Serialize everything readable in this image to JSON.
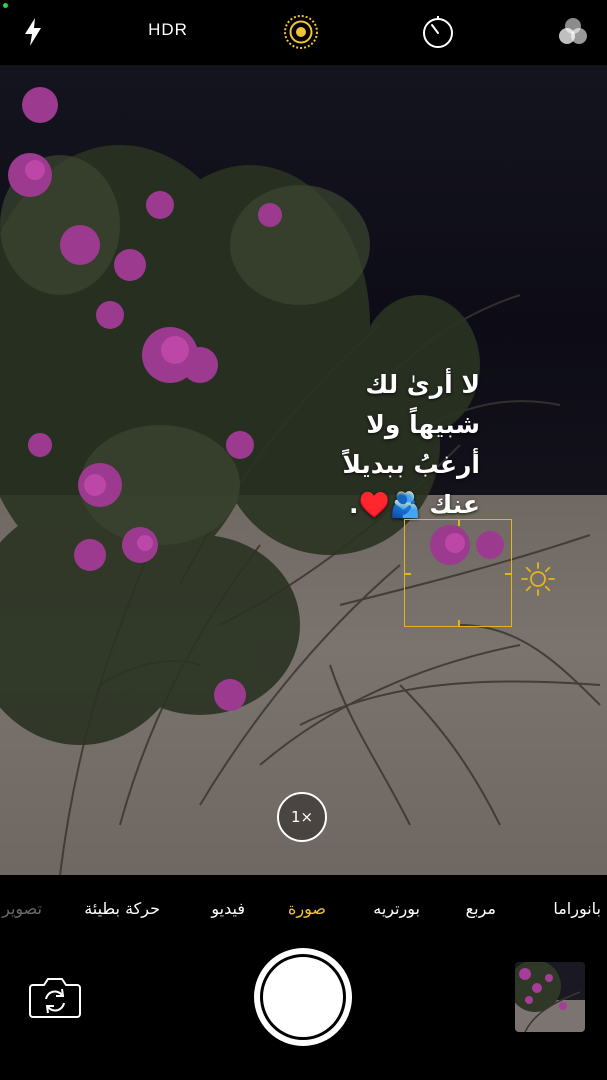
{
  "top_bar": {
    "flash_icon": "flash-icon",
    "hdr_label": "HDR",
    "live_photo_icon": "live-photo-icon",
    "timer_icon": "timer-icon",
    "filters_icon": "filters-icon",
    "accent_color": "#f3c338"
  },
  "viewfinder": {
    "overlay_text": "لا أرىٰ لك\nشبيهاً ولا\nأرغبُ ببديلاً\nعنك 🫂♥️.",
    "zoom_label": "1×",
    "focus_color": "#e3b51d",
    "exposure_icon": "sun-icon"
  },
  "modes": {
    "items": [
      {
        "label": "تصوير",
        "state": "faded"
      },
      {
        "label": "حركة بطيئة",
        "state": "normal"
      },
      {
        "label": "فيديو",
        "state": "normal"
      },
      {
        "label": "صورة",
        "state": "active"
      },
      {
        "label": "بورتريه",
        "state": "normal"
      },
      {
        "label": "مربع",
        "state": "normal"
      },
      {
        "label": "بانوراما",
        "state": "normal"
      }
    ]
  },
  "bottom_bar": {
    "flip_icon": "camera-flip-icon",
    "shutter_icon": "shutter-button",
    "thumbnail_icon": "last-photo-thumbnail"
  }
}
